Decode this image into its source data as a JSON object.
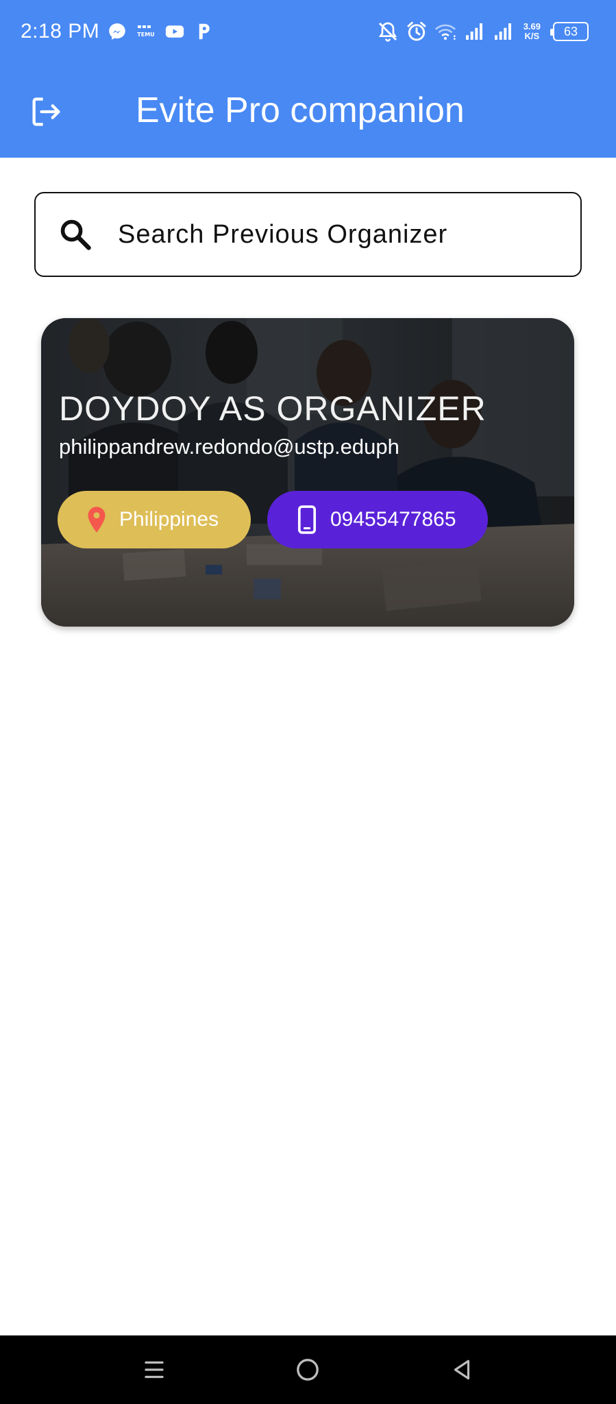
{
  "status_bar": {
    "time": "2:18 PM",
    "left_icons": [
      "messenger-icon",
      "temu-icon",
      "youtube-icon",
      "pandora-icon"
    ],
    "right_icons": [
      "notifications-off-icon",
      "alarm-icon",
      "wifi-icon",
      "signal-icon",
      "signal-icon"
    ],
    "net_speed_value": "3.69",
    "net_speed_unit": "K/S",
    "battery_level": "63"
  },
  "app_bar": {
    "title": "Evite Pro companion",
    "background_color": "#4889f4",
    "leading_icon": "logout-icon"
  },
  "search": {
    "placeholder": "Search Previous Organizer",
    "value": "",
    "icon": "search-icon"
  },
  "organizers": [
    {
      "name": "DOYDOY AS ORGANIZER",
      "email": "philippandrew.redondo@ustp.eduph",
      "location": "Philippines",
      "location_icon": "location-pin-icon",
      "location_chip_color": "#debe57",
      "phone": "09455477865",
      "phone_icon": "smartphone-icon",
      "phone_chip_color": "#5a22d8"
    }
  ],
  "nav_bar": {
    "buttons": [
      "menu-icon",
      "home-icon",
      "back-icon"
    ]
  }
}
